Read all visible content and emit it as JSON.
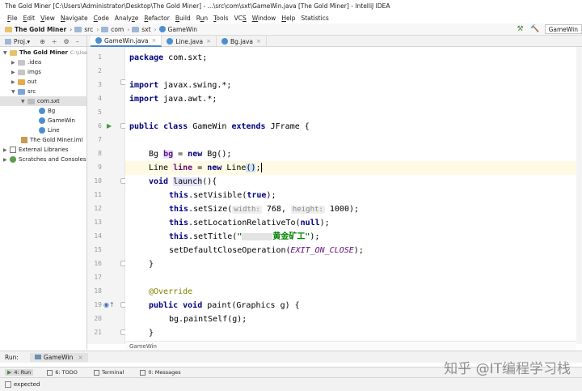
{
  "window": {
    "title": "The Gold Miner [C:\\Users\\Administrator\\Desktop\\The Gold Miner] - ...\\src\\com\\sxt\\GameWin.java [The Gold Miner] - IntelliJ IDEA"
  },
  "menu": [
    {
      "pre": "",
      "ul": "F",
      "post": "ile"
    },
    {
      "pre": "",
      "ul": "E",
      "post": "dit"
    },
    {
      "pre": "",
      "ul": "V",
      "post": "iew"
    },
    {
      "pre": "",
      "ul": "N",
      "post": "avigate"
    },
    {
      "pre": "",
      "ul": "C",
      "post": "ode"
    },
    {
      "pre": "Analy",
      "ul": "z",
      "post": "e"
    },
    {
      "pre": "",
      "ul": "R",
      "post": "efactor"
    },
    {
      "pre": "",
      "ul": "B",
      "post": "uild"
    },
    {
      "pre": "R",
      "ul": "u",
      "post": "n"
    },
    {
      "pre": "",
      "ul": "T",
      "post": "ools"
    },
    {
      "pre": "VC",
      "ul": "S",
      "post": ""
    },
    {
      "pre": "",
      "ul": "W",
      "post": "indow"
    },
    {
      "pre": "",
      "ul": "H",
      "post": "elp"
    },
    {
      "pre": "Statistics",
      "ul": "",
      "post": ""
    }
  ],
  "breadcrumbs": [
    "The Gold Miner",
    "src",
    "com",
    "sxt",
    "GameWin"
  ],
  "run_config": "GameWin",
  "project_panel": {
    "label": "Proj.▾",
    "tree": {
      "root": "The Gold Miner",
      "root_path": "C:\\Users",
      "idea": ".idea",
      "imgs": "imgs",
      "out": "out",
      "src": "src",
      "pkg": "com.sxt",
      "bg": "Bg",
      "gamewin": "GameWin",
      "line": "Line",
      "iml": "The Gold Miner.iml",
      "ext": "External Libraries",
      "scratch": "Scratches and Consoles"
    }
  },
  "editor_tabs": [
    {
      "label": "GameWin.java",
      "active": true
    },
    {
      "label": "Line.java",
      "active": false
    },
    {
      "label": "Bg.java",
      "active": false
    }
  ],
  "code": {
    "line_numbers": [
      "1",
      "2",
      "3",
      "4",
      "5",
      "6",
      "7",
      "8",
      "9",
      "10",
      "11",
      "12",
      "13",
      "14",
      "15",
      "16",
      "17",
      "18",
      "19",
      "20",
      "21"
    ],
    "l1_kw": "package",
    "l1_rest": " com.sxt;",
    "l3_kw": "import",
    "l3_rest": " javax.swing.*;",
    "l4_kw": "import",
    "l4_rest": " java.awt.*;",
    "l6_kw1": "public class",
    "l6_name": " GameWin ",
    "l6_kw2": "extends",
    "l6_rest": " JFrame {",
    "l8_type": "Bg ",
    "l8_var": "bg",
    "l8_eq": " = ",
    "l8_kw": "new",
    "l8_rest": " Bg();",
    "l9_type": "Line ",
    "l9_var": "line",
    "l9_eq": " = ",
    "l9_kw": "new",
    "l9_rest": " Line",
    "l9_parens": "()",
    "l9_end": ";",
    "l10_kw": "void",
    "l10_name": "launch",
    "l10_rest": "(){",
    "l11_kw": "this",
    "l11_rest": ".setVisible(",
    "l11_val": "true",
    "l11_end": ");",
    "l12_kw": "this",
    "l12_rest": ".setSize(",
    "l12_hint1": "width:",
    "l12_v1": " 768, ",
    "l12_hint2": "height:",
    "l12_v2": " 1000);",
    "l13_kw": "this",
    "l13_rest": ".setLocationRelativeTo(",
    "l13_val": "null",
    "l13_end": ");",
    "l14_kw": "this",
    "l14_rest": ".setTitle(",
    "l14_q": "\"",
    "l14_str": "黄金矿工\"",
    "l14_end": ");",
    "l15": "setDefaultCloseOperation(",
    "l15_const": "EXIT_ON_CLOSE",
    "l15_end": ");",
    "l16": "}",
    "l18": "@Override",
    "l19_kw": "public void",
    "l19_rest": " paint(Graphics g) {",
    "l20": "bg.paintSelf(g);",
    "l21": "}"
  },
  "editor_footer": "GameWin",
  "run_panel": {
    "label": "Run:",
    "tab": "GameWin"
  },
  "tool_windows": [
    "4: Run",
    "6: TODO",
    "Terminal",
    "0: Messages"
  ],
  "status": "expected",
  "watermark": "知乎 @IT编程学习栈"
}
